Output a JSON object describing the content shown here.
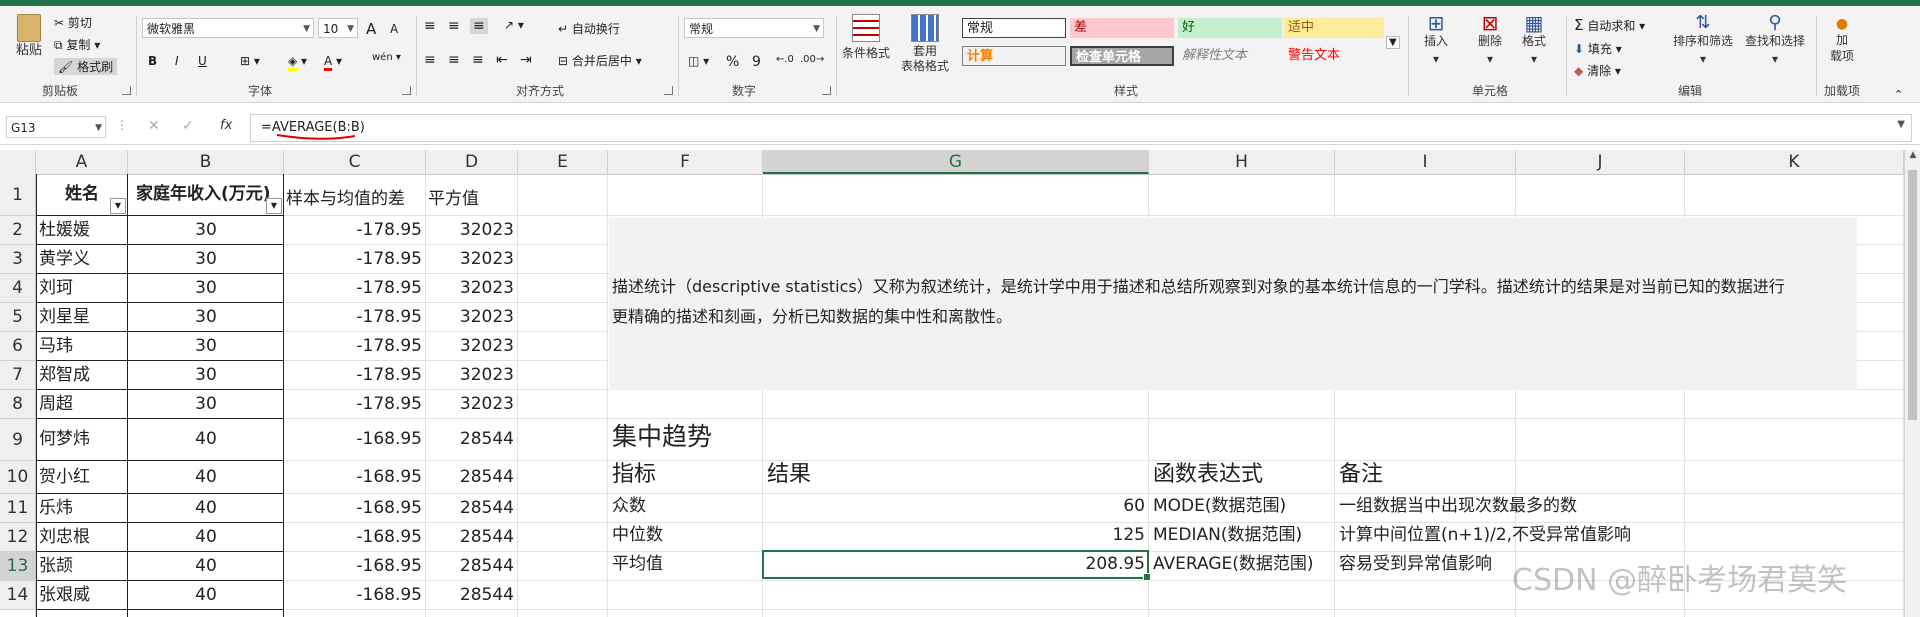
{
  "ribbon": {
    "clipboard": {
      "paste": "粘贴",
      "cut": "剪切",
      "copy": "复制",
      "format_painter": "格式刷",
      "title": "剪贴板"
    },
    "font": {
      "name": "微软雅黑",
      "size": "10",
      "bold": "B",
      "italic": "I",
      "underline": "U",
      "phonetic": "wén",
      "title": "字体",
      "grow": "A",
      "shrink": "A"
    },
    "alignment": {
      "wrap": "自动换行",
      "merge": "合并后居中",
      "title": "对齐方式"
    },
    "number": {
      "format": "常规",
      "percent": "%",
      "comma": "9",
      "title": "数字"
    },
    "styles": {
      "conditional": "条件格式",
      "table": "套用\n表格格式",
      "normal": "常规",
      "bad": "差",
      "good": "好",
      "neutral": "适中",
      "calc": "计算",
      "check": "检查单元格",
      "explain": "解释性文本",
      "warning": "警告文本",
      "title": "样式",
      "colors": {
        "bad_bg": "#ffc7ce",
        "bad_fg": "#9c0006",
        "good_bg": "#c6efce",
        "good_fg": "#006100",
        "neutral_bg": "#ffeb9c",
        "neutral_fg": "#9c5700",
        "calc_fg": "#fa7d00",
        "check_bg": "#a5a5a5",
        "warning_fg": "#ff0000"
      }
    },
    "cells": {
      "insert": "插入",
      "delete": "删除",
      "format": "格式",
      "title": "单元格"
    },
    "editing": {
      "autosum": "自动求和",
      "fill": "填充",
      "clear": "清除",
      "sort": "排序和筛选",
      "find": "查找和选择",
      "title": "编辑"
    },
    "addins": {
      "label": "加\n载项",
      "title": "加载项"
    }
  },
  "formula_bar": {
    "name_box": "G13",
    "formula": "=AVERAGE(B:B)",
    "fx": "fx"
  },
  "columns": [
    "A",
    "B",
    "C",
    "D",
    "E",
    "F",
    "G",
    "H",
    "I",
    "J",
    "K"
  ],
  "rows": [
    "1",
    "2",
    "3",
    "4",
    "5",
    "6",
    "7",
    "8",
    "9",
    "10",
    "11",
    "12",
    "13",
    "14"
  ],
  "table": {
    "headers": [
      "姓名",
      "家庭年收入(万元)",
      "样本与均值的差",
      "平方值"
    ],
    "data": [
      [
        "杜媛媛",
        "30",
        "-178.95",
        "32023"
      ],
      [
        "黄学义",
        "30",
        "-178.95",
        "32023"
      ],
      [
        "刘珂",
        "30",
        "-178.95",
        "32023"
      ],
      [
        "刘星星",
        "30",
        "-178.95",
        "32023"
      ],
      [
        "马玮",
        "30",
        "-178.95",
        "32023"
      ],
      [
        "郑智成",
        "30",
        "-178.95",
        "32023"
      ],
      [
        "周超",
        "30",
        "-178.95",
        "32023"
      ],
      [
        "何梦炜",
        "40",
        "-168.95",
        "28544"
      ],
      [
        "贺小红",
        "40",
        "-168.95",
        "28544"
      ],
      [
        "乐炜",
        "40",
        "-168.95",
        "28544"
      ],
      [
        "刘忠根",
        "40",
        "-168.95",
        "28544"
      ],
      [
        "张颉",
        "40",
        "-168.95",
        "28544"
      ],
      [
        "张艰威",
        "40",
        "-168.95",
        "28544"
      ]
    ]
  },
  "description": {
    "line1": "描述统计（descriptive statistics）又称为叙述统计，是统计学中用于描述和总结所观察到对象的基本统计信息的一门学科。描述统计的结果是对当前已知的数据进行",
    "line2": "更精确的描述和刻画，分析已知数据的集中性和离散性。"
  },
  "central": {
    "title": "集中趋势",
    "headers": [
      "指标",
      "结果",
      "函数表达式",
      "备注"
    ],
    "rows": [
      [
        "众数",
        "60",
        "MODE(数据范围)",
        "一组数据当中出现次数最多的数"
      ],
      [
        "中位数",
        "125",
        "MEDIAN(数据范围)",
        "计算中间位置(n+1)/2,不受异常值影响"
      ],
      [
        "平均值",
        "208.95",
        "AVERAGE(数据范围)",
        "容易受到异常值影响"
      ]
    ]
  },
  "watermark": "CSDN @醉卧考场君莫笑"
}
